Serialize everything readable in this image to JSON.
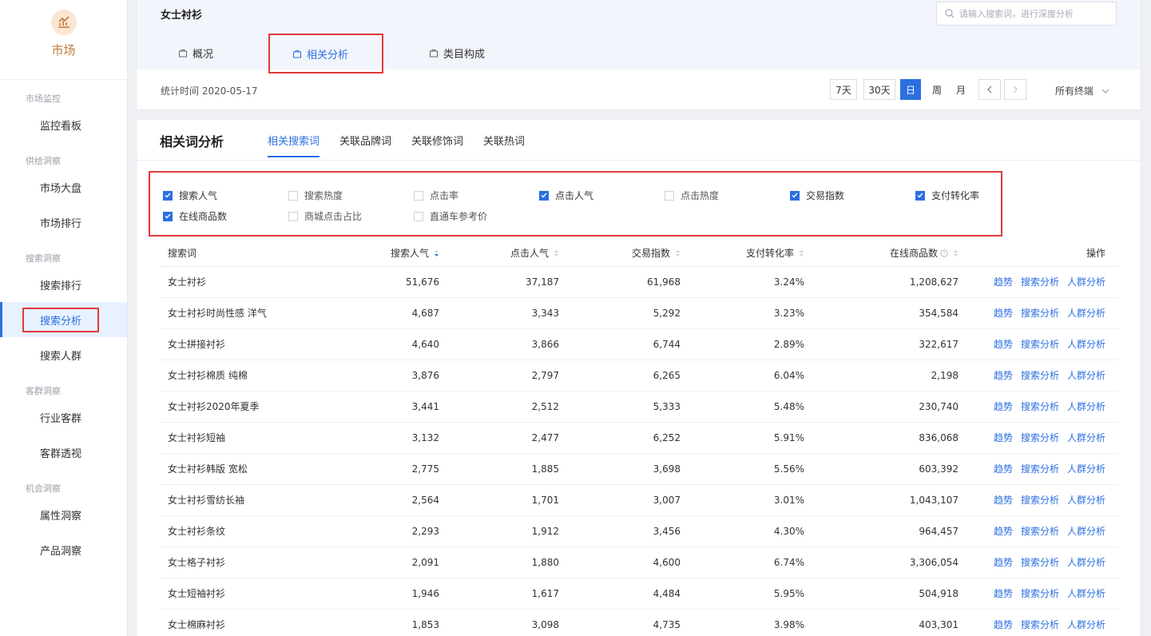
{
  "app": {
    "name": "市场"
  },
  "sidebar": {
    "groups": [
      {
        "label": "市场监控",
        "items": [
          {
            "label": "监控看板"
          }
        ]
      },
      {
        "label": "供给洞察",
        "items": [
          {
            "label": "市场大盘"
          },
          {
            "label": "市场排行"
          }
        ]
      },
      {
        "label": "搜索洞察",
        "items": [
          {
            "label": "搜索排行"
          },
          {
            "label": "搜索分析"
          },
          {
            "label": "搜索人群"
          }
        ]
      },
      {
        "label": "客群洞察",
        "items": [
          {
            "label": "行业客群"
          },
          {
            "label": "客群透视"
          }
        ]
      },
      {
        "label": "机会洞察",
        "items": [
          {
            "label": "属性洞察"
          },
          {
            "label": "产品洞察"
          }
        ]
      }
    ],
    "active": "搜索分析"
  },
  "header": {
    "category": "女士衬衫",
    "search_placeholder": "请输入搜索词，进行深度分析",
    "tabs": [
      {
        "label": "概况"
      },
      {
        "label": "相关分析"
      },
      {
        "label": "类目构成"
      }
    ],
    "active_tab": "相关分析",
    "stat_time": "统计时间 2020-05-17",
    "date_buttons": [
      "7天",
      "30天",
      "日",
      "周",
      "月"
    ],
    "active_date": "日",
    "terminal": "所有终端"
  },
  "main": {
    "title": "相关词分析",
    "subtabs": [
      {
        "label": "相关搜索词"
      },
      {
        "label": "关联品牌词"
      },
      {
        "label": "关联修饰词"
      },
      {
        "label": "关联热词"
      }
    ],
    "active_subtab": "相关搜索词",
    "filters": [
      {
        "label": "搜索人气",
        "checked": true
      },
      {
        "label": "搜索热度",
        "checked": false
      },
      {
        "label": "点击率",
        "checked": false
      },
      {
        "label": "点击人气",
        "checked": true
      },
      {
        "label": "点击热度",
        "checked": false
      },
      {
        "label": "交易指数",
        "checked": true
      },
      {
        "label": "支付转化率",
        "checked": true
      },
      {
        "label": "在线商品数",
        "checked": true
      },
      {
        "label": "商城点击占比",
        "checked": false
      },
      {
        "label": "直通车参考价",
        "checked": false
      }
    ],
    "table": {
      "headers": [
        "搜索词",
        "搜索人气",
        "点击人气",
        "交易指数",
        "支付转化率",
        "在线商品数",
        "操作"
      ],
      "ops": [
        "趋势",
        "搜索分析",
        "人群分析"
      ],
      "rows": [
        [
          "女士衬衫",
          "51,676",
          "37,187",
          "61,968",
          "3.24%",
          "1,208,627"
        ],
        [
          "女士衬衫时尚性感 洋气",
          "4,687",
          "3,343",
          "5,292",
          "3.23%",
          "354,584"
        ],
        [
          "女士拼接衬衫",
          "4,640",
          "3,866",
          "6,744",
          "2.89%",
          "322,617"
        ],
        [
          "女士衬衫棉质 纯棉",
          "3,876",
          "2,797",
          "6,265",
          "6.04%",
          "2,198"
        ],
        [
          "女士衬衫2020年夏季",
          "3,441",
          "2,512",
          "5,333",
          "5.48%",
          "230,740"
        ],
        [
          "女士衬衫短袖",
          "3,132",
          "2,477",
          "6,252",
          "5.91%",
          "836,068"
        ],
        [
          "女士衬衫韩版 宽松",
          "2,775",
          "1,885",
          "3,698",
          "5.56%",
          "603,392"
        ],
        [
          "女士衬衫雪纺长袖",
          "2,564",
          "1,701",
          "3,007",
          "3.01%",
          "1,043,107"
        ],
        [
          "女士衬衫条纹",
          "2,293",
          "1,912",
          "3,456",
          "4.30%",
          "964,457"
        ],
        [
          "女士格子衬衫",
          "2,091",
          "1,880",
          "4,600",
          "6.74%",
          "3,306,054"
        ],
        [
          "女士短袖衬衫",
          "1,946",
          "1,617",
          "4,484",
          "5.95%",
          "504,918"
        ],
        [
          "女士棉麻衬衫",
          "1,853",
          "3,098",
          "4,735",
          "3.98%",
          "403,301"
        ]
      ]
    }
  },
  "colors": {
    "accent": "#2b6fe0",
    "highlight": "#e03a3a",
    "brand": "#c07a3a"
  }
}
